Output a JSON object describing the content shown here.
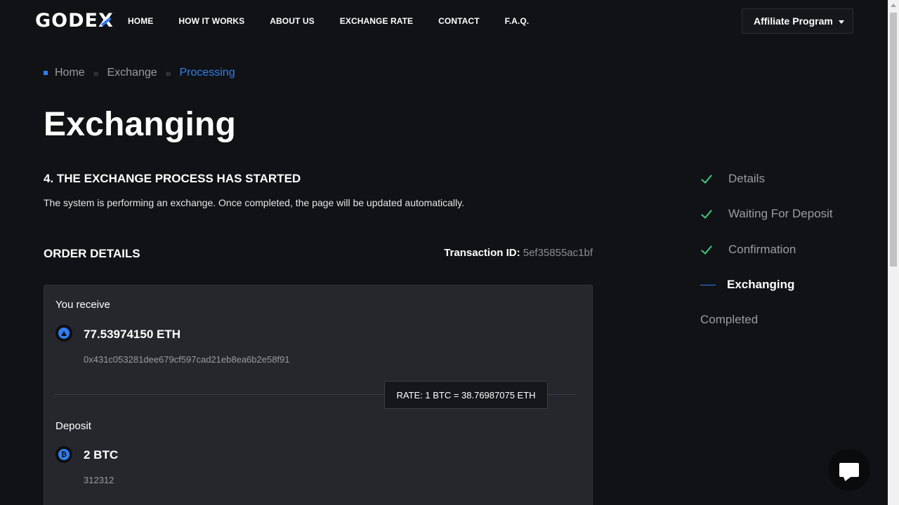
{
  "header": {
    "logo": "GODEX",
    "nav": [
      "HOME",
      "HOW IT WORKS",
      "ABOUT US",
      "EXCHANGE RATE",
      "CONTACT",
      "F.A.Q."
    ],
    "affiliate_label": "Affiliate Program"
  },
  "breadcrumb": {
    "items": [
      "Home",
      "Exchange",
      "Processing"
    ],
    "separator": "»"
  },
  "page_title": "Exchanging",
  "step": {
    "heading": "4. THE EXCHANGE PROCESS HAS STARTED",
    "description": "The system is performing an exchange. Once completed, the page will be updated automatically."
  },
  "order": {
    "title": "ORDER DETAILS",
    "transaction_label": "Transaction ID:",
    "transaction_id": "5ef35855ac1bf",
    "receive": {
      "label": "You receive",
      "amount": "77.53974150 ETH",
      "address": "0x431c053281dee679cf597cad21eb8ea6b2e58f91",
      "icon": "ethereum-icon"
    },
    "rate": "RATE: 1 BTC = 38.76987075 ETH",
    "deposit": {
      "label": "Deposit",
      "amount": "2 BTC",
      "address": "312312",
      "icon": "bitcoin-icon"
    }
  },
  "progress_steps": [
    {
      "label": "Details",
      "state": "done"
    },
    {
      "label": "Waiting For Deposit",
      "state": "done"
    },
    {
      "label": "Confirmation",
      "state": "done"
    },
    {
      "label": "Exchanging",
      "state": "active"
    },
    {
      "label": "Completed",
      "state": "pending"
    }
  ],
  "colors": {
    "background": "#111216",
    "accent": "#2f7ff0",
    "success": "#3ec87a",
    "card": "#25272c"
  }
}
